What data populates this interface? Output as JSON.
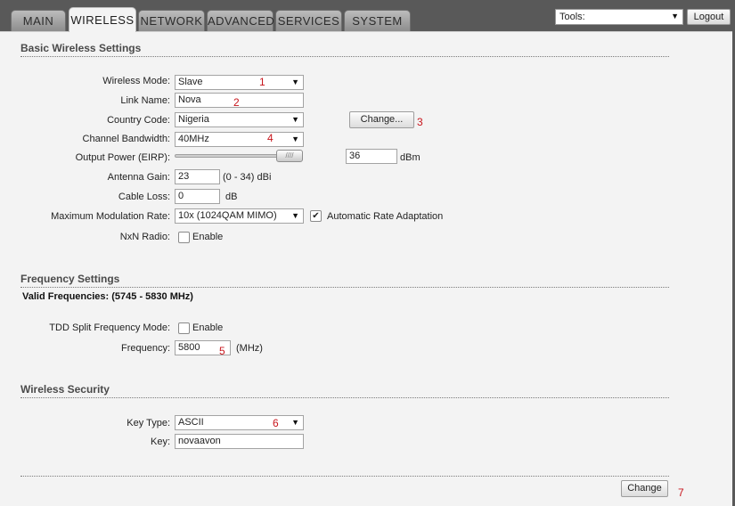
{
  "tabs": [
    {
      "label": "MAIN"
    },
    {
      "label": "WIRELESS",
      "active": true
    },
    {
      "label": "NETWORK"
    },
    {
      "label": "ADVANCED"
    },
    {
      "label": "SERVICES"
    },
    {
      "label": "SYSTEM"
    }
  ],
  "header": {
    "tools_select_value": "Tools:",
    "logout_label": "Logout"
  },
  "basic": {
    "title": "Basic Wireless Settings",
    "wireless_mode": {
      "label": "Wireless Mode:",
      "value": "Slave",
      "marker": "1"
    },
    "link_name": {
      "label": "Link Name:",
      "value": "Nova",
      "marker": "2"
    },
    "country_code": {
      "label": "Country Code:",
      "value": "Nigeria",
      "change_label": "Change...",
      "marker": "3"
    },
    "channel_bandwidth": {
      "label": "Channel Bandwidth:",
      "value": "40MHz",
      "marker": "4"
    },
    "output_power": {
      "label": "Output Power (EIRP):",
      "value": "36",
      "unit": "dBm",
      "slider_level": 1.0
    },
    "antenna_gain": {
      "label": "Antenna Gain:",
      "value": "23",
      "unit": "(0 - 34) dBi"
    },
    "cable_loss": {
      "label": "Cable Loss:",
      "value": "0",
      "unit": "dB"
    },
    "max_modulation": {
      "label": "Maximum Modulation Rate:",
      "value": "10x (1024QAM MIMO)",
      "auto_label": "Automatic Rate Adaptation",
      "auto_checked": true
    },
    "nxn_radio": {
      "label": "NxN Radio:",
      "enable_label": "Enable",
      "checked": false
    }
  },
  "frequency": {
    "title": "Frequency Settings",
    "valid_frequencies": "Valid Frequencies: (5745 - 5830 MHz)",
    "tdd_split": {
      "label": "TDD Split Frequency Mode:",
      "enable_label": "Enable",
      "checked": false
    },
    "frequency": {
      "label": "Frequency:",
      "value": "5800",
      "unit": "(MHz)",
      "marker": "5"
    }
  },
  "security": {
    "title": "Wireless Security",
    "key_type": {
      "label": "Key Type:",
      "value": "ASCII",
      "marker": "6"
    },
    "key": {
      "label": "Key:",
      "value": "novaavon"
    }
  },
  "footer": {
    "change_label": "Change",
    "marker": "7"
  }
}
